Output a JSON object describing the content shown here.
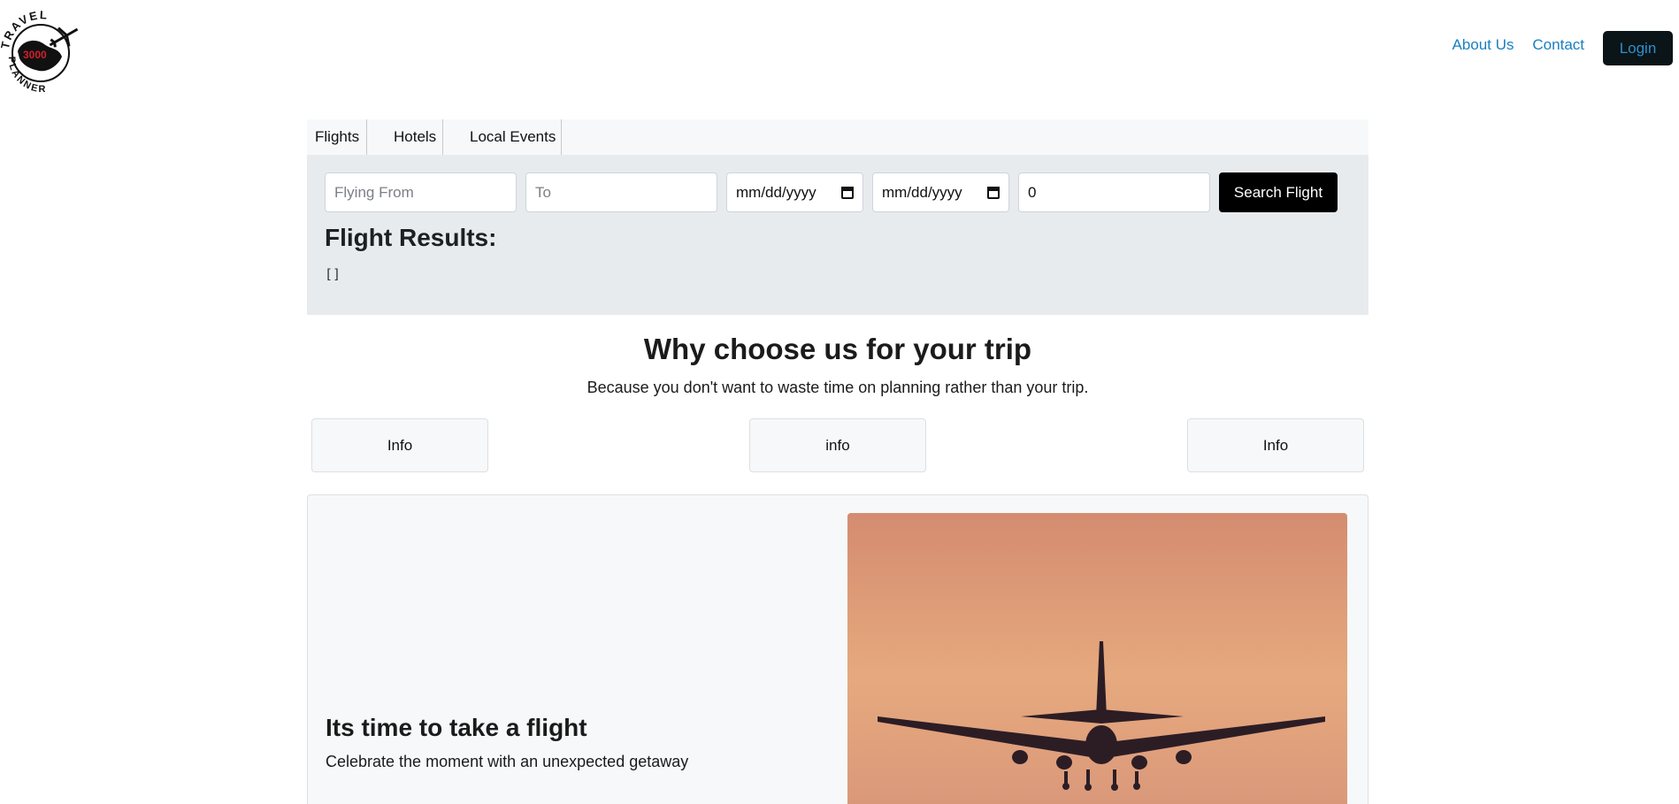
{
  "header": {
    "logo": {
      "top_text": "TRAVEL",
      "bottom_text": "PLANNER",
      "mark_text": "3000"
    },
    "nav": [
      {
        "label": "About Us"
      },
      {
        "label": "Contact"
      }
    ],
    "login_label": "Login"
  },
  "tabs": [
    {
      "label": "Flights"
    },
    {
      "label": "Hotels"
    },
    {
      "label": "Local Events"
    }
  ],
  "search": {
    "from_placeholder": "Flying From",
    "to_placeholder": "To",
    "depart_date": "mm/dd/yyyy",
    "return_date": "mm/dd/yyyy",
    "passengers": "0",
    "button_label": "Search Flight"
  },
  "results": {
    "title": "Flight Results:",
    "json": "[]"
  },
  "why": {
    "title": "Why choose us for your trip",
    "subtitle": "Because you don't want to waste time on planning rather than your trip.",
    "boxes": [
      "Info",
      "info",
      "Info"
    ]
  },
  "hero": {
    "title": "Its time to take a flight",
    "subtitle": "Celebrate the moment with an unexpected getaway"
  },
  "colors": {
    "link": "#1a7fbf",
    "panel_bg": "#e8ebee",
    "sunset_top": "#d48c70",
    "sunset_mid": "#e6a97e"
  }
}
